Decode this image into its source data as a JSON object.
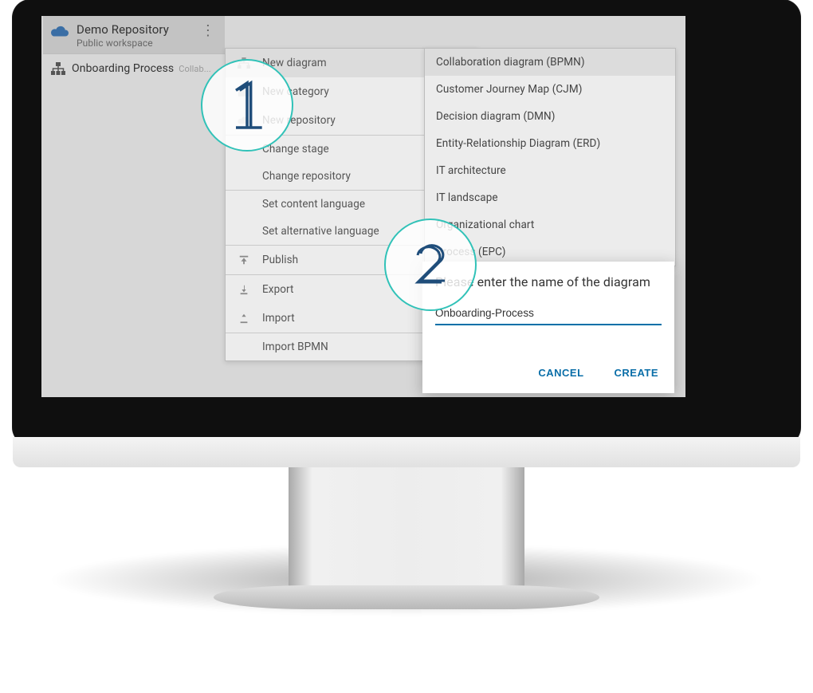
{
  "sidebar": {
    "repo": {
      "name": "Demo Repository",
      "subtitle": "Public workspace"
    },
    "tree": {
      "item_label": "Onboarding Process",
      "item_sub": "Collab..."
    }
  },
  "ctx": {
    "new_diagram": "New diagram",
    "new_category": "New category",
    "new_repository": "New repository",
    "change_stage": "Change stage",
    "change_repository": "Change repository",
    "set_content_lang": "Set content language",
    "set_alt_lang": "Set alternative language",
    "publish": "Publish",
    "export": "Export",
    "import": "Import",
    "import_bpmn": "Import BPMN"
  },
  "submenu": {
    "items": [
      "Collaboration diagram (BPMN)",
      "Customer Journey Map (CJM)",
      "Decision diagram (DMN)",
      "Entity-Relationship Diagram (ERD)",
      "IT architecture",
      "IT landscape",
      "Organizational chart",
      "Process (EPC)"
    ]
  },
  "dialog": {
    "title": "Please enter the name of the diagram",
    "value": "Onboarding-Process",
    "cancel": "CANCEL",
    "create": "CREATE"
  }
}
